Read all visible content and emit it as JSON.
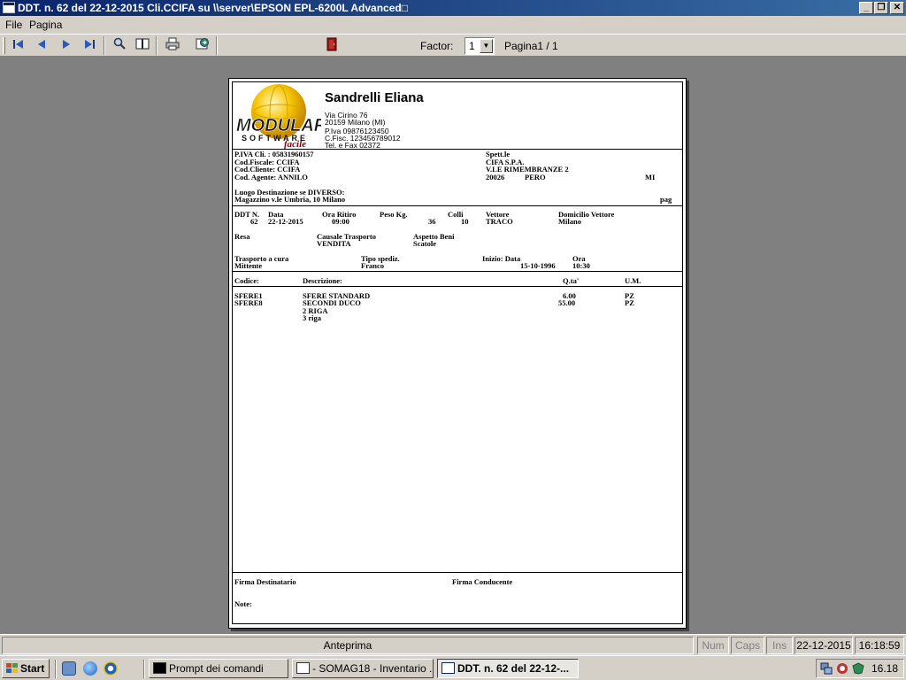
{
  "window": {
    "title": "DDT. n.  62 del 22-12-2015 Cli.CCIFA su \\\\server\\EPSON EPL-6200L Advanced□",
    "minimize": "_",
    "restore": "❐",
    "close": "✕"
  },
  "menu": {
    "file": "File",
    "pagina": "Pagina"
  },
  "toolbar": {
    "factor_label": "Factor:",
    "factor_value": "1",
    "page_label": "Pagina1 / 1",
    "icons": [
      "first-page-icon",
      "previous-page-icon",
      "next-page-icon",
      "last-page-icon",
      "zoom-icon",
      "two-pages-icon",
      "print-icon",
      "export-icon",
      "exit-door-icon"
    ]
  },
  "document": {
    "logo": {
      "brand": "MODULAR",
      "sub": "SOFTWARE",
      "script": "facile"
    },
    "company": {
      "name": "Sandrelli Eliana",
      "address": "Via Cirino 76",
      "city": "20159 Milano (MI)",
      "piva": "P.Iva 09876123450",
      "cfisc": "C.Fisc. 123456789012",
      "tel": "Tel. e Fax 02372"
    },
    "client": {
      "piva_line": "P.IVA Cli. : 05831960157",
      "cf_line": "Cod.Fiscale: CCIFA",
      "cc_line": "Cod.Cliente: CCIFA",
      "ag_line": "Cod. Agente: ANNILO",
      "spett": "Spett.le",
      "ragione": "CIFA S.P.A.",
      "via": "V.LE RIMEMBRANZE 2",
      "cap": "20026",
      "citta": "PERO",
      "prov": "MI"
    },
    "destination": {
      "label": "Luogo Destinazione se DIVERSO:",
      "value": "Magazzino v.le Umbria, 10 Milano",
      "pag": "pag"
    },
    "transport": {
      "h_ddt": "DDT N.",
      "h_data": "Data",
      "h_ora": "Ora Ritiro",
      "h_peso": "Peso Kg.",
      "h_colli": "Colli",
      "h_vettore": "Vettore",
      "h_domicilio": "Domicilio Vettore",
      "v_ddt": "62",
      "v_data": "22-12-2015",
      "v_ora": "09:00",
      "v_peso": "36",
      "v_colli": "10",
      "v_vettore": "TRACO",
      "v_domicilio": "Milano",
      "h_resa": "Resa",
      "h_causale": "Causale Trasporto",
      "h_aspetto": "Aspetto Beni",
      "v_causale": "VENDITA",
      "v_aspetto": "Scatole",
      "h_cura": "Trasporto a cura",
      "h_tipo": "Tipo spediz.",
      "h_inizio": "Inizio: Data",
      "h_ora2": "Ora",
      "v_cura": "Mittente",
      "v_tipo": "Franco",
      "v_inizio": "15-10-1996",
      "v_ora2": "10:30"
    },
    "items": {
      "h_codice": "Codice:",
      "h_descrizione": "Descrizione:",
      "h_qta": "Q.ta'",
      "h_um": "U.M.",
      "rows": [
        {
          "codice": "SFERE1",
          "descrizione": "SFERE STANDARD",
          "qta": "6.00",
          "um": "PZ"
        },
        {
          "codice": "SFERE8",
          "descrizione": "SECONDI DUCO",
          "qta": "55.00",
          "um": "PZ"
        },
        {
          "codice": "",
          "descrizione": "2 RIGA",
          "qta": "",
          "um": ""
        },
        {
          "codice": "",
          "descrizione": "3 riga",
          "qta": "",
          "um": ""
        }
      ]
    },
    "footer": {
      "firma_dest": "Firma Destinatario",
      "firma_cond": "Firma Conducente",
      "note": "Note:"
    }
  },
  "statusbar": {
    "mode": "Anteprima",
    "num": "Num",
    "caps": "Caps",
    "ins": "Ins",
    "date": "22-12-2015",
    "time": "16:18:59"
  },
  "taskbar": {
    "start": "Start",
    "tasks": [
      {
        "label": "Prompt dei comandi"
      },
      {
        "label": "- SOMAG18 - Inventario ..."
      },
      {
        "label": "DDT. n.  62 del 22-12-..."
      }
    ],
    "clock": "16.18"
  }
}
